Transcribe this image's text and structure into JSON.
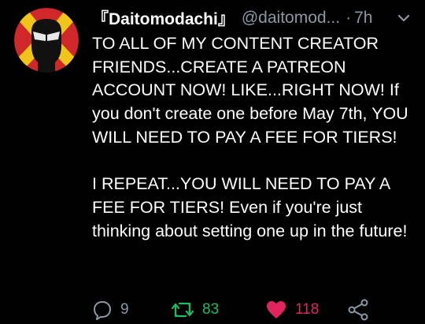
{
  "tweet": {
    "display_name": "『Daitomodachi』",
    "handle": "@daitomod...",
    "separator": "·",
    "time": "7h",
    "paragraphs": [
      "TO ALL OF MY CONTENT CREATOR FRIENDS...CREATE A PATREON ACCOUNT NOW! LIKE...RIGHT NOW! If you don't create one before May 7th, YOU WILL NEED TO PAY A FEE FOR TIERS!",
      "I REPEAT...YOU WILL NEED TO PAY A FEE FOR TIERS! Even if you're just thinking about setting one up in the future!"
    ]
  },
  "actions": {
    "reply_count": "9",
    "retweet_count": "83",
    "like_count": "118"
  },
  "icons": {
    "reply": "reply-icon",
    "retweet": "retweet-icon",
    "like": "heart-icon",
    "share": "share-icon",
    "menu": "chevron-down-icon"
  },
  "colors": {
    "background": "#000000",
    "text": "#ffffff",
    "muted": "#8899a6",
    "retweet_active": "#17bf63",
    "like_active": "#e0245e",
    "avatar_bg": "#d0282a",
    "avatar_accent": "#f0c419"
  }
}
